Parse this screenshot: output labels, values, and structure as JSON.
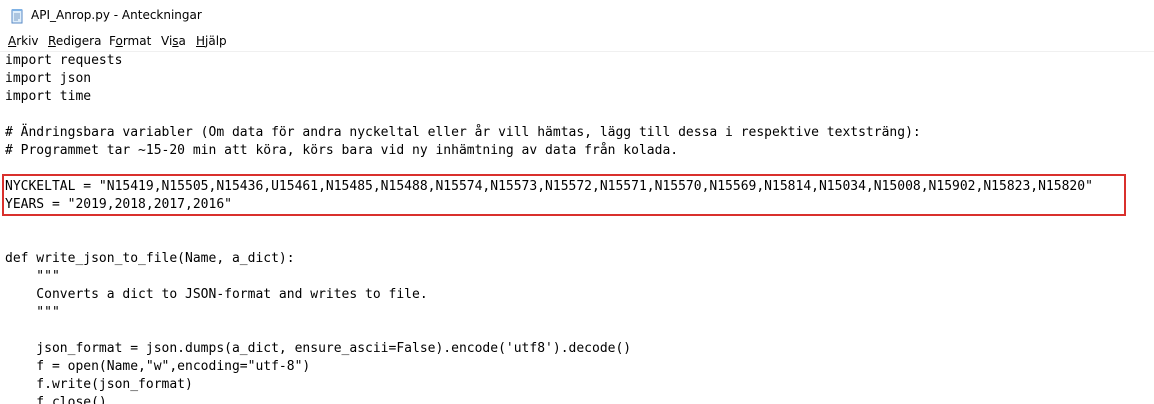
{
  "window": {
    "title": "API_Anrop.py - Anteckningar"
  },
  "menu": {
    "items": [
      {
        "pre": "",
        "ul": "A",
        "post": "rkiv"
      },
      {
        "pre": "",
        "ul": "R",
        "post": "edigera"
      },
      {
        "pre": "F",
        "ul": "o",
        "post": "rmat"
      },
      {
        "pre": "Vi",
        "ul": "s",
        "post": "a"
      },
      {
        "pre": "",
        "ul": "H",
        "post": "jälp"
      }
    ]
  },
  "code": {
    "lines": [
      "import requests",
      "import json",
      "import time",
      "",
      "# Ändringsbara variabler (Om data för andra nyckeltal eller år vill hämtas, lägg till dessa i respektive textsträng):",
      "# Programmet tar ~15-20 min att köra, körs bara vid ny inhämtning av data från kolada.",
      "",
      "NYCKELTAL = \"N15419,N15505,N15436,U15461,N15485,N15488,N15574,N15573,N15572,N15571,N15570,N15569,N15814,N15034,N15008,N15902,N15823,N15820\"",
      "YEARS = \"2019,2018,2017,2016\"",
      "",
      "",
      "def write_json_to_file(Name, a_dict):",
      "    \"\"\"",
      "    Converts a dict to JSON-format and writes to file.",
      "    \"\"\"",
      "",
      "    json_format = json.dumps(a_dict, ensure_ascii=False).encode('utf8').decode()",
      "    f = open(Name,\"w\",encoding=\"utf-8\")",
      "    f.write(json_format)",
      "    f.close()"
    ]
  },
  "colors": {
    "highlight_border": "#d9302c"
  },
  "icons": {
    "app": "notepad-icon"
  }
}
